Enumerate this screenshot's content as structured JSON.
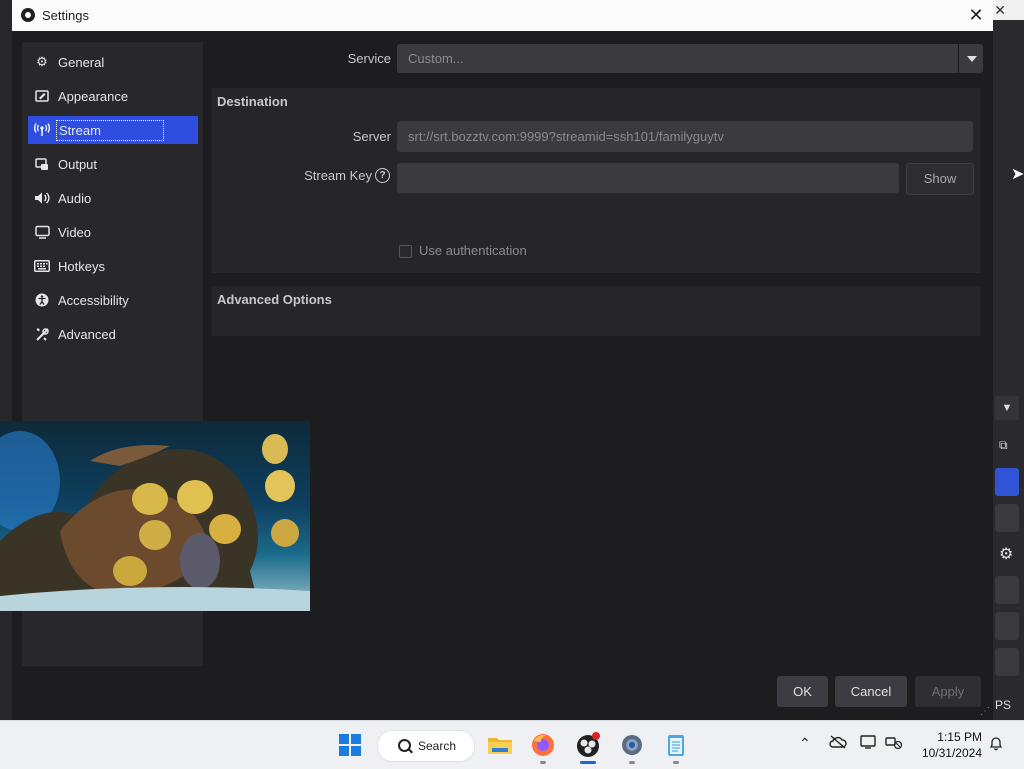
{
  "dialog": {
    "title": "Settings",
    "close_glyph": "✕"
  },
  "sidebar": {
    "items": [
      {
        "label": "General",
        "icon": "gear-icon"
      },
      {
        "label": "Appearance",
        "icon": "appearance-icon"
      },
      {
        "label": "Stream",
        "icon": "antenna-icon",
        "active": true
      },
      {
        "label": "Output",
        "icon": "output-icon"
      },
      {
        "label": "Audio",
        "icon": "speaker-icon"
      },
      {
        "label": "Video",
        "icon": "monitor-icon"
      },
      {
        "label": "Hotkeys",
        "icon": "keyboard-icon"
      },
      {
        "label": "Accessibility",
        "icon": "accessibility-icon"
      },
      {
        "label": "Advanced",
        "icon": "tools-icon"
      }
    ]
  },
  "stream": {
    "service_label": "Service",
    "service_value": "Custom...",
    "destination_title": "Destination",
    "server_label": "Server",
    "server_value": "srt://srt.bozztv.com:9999?streamid=ssh101/familyguytv",
    "stream_key_label": "Stream Key",
    "stream_key_value": "",
    "show_button": "Show",
    "use_auth_label": "Use authentication",
    "use_auth_checked": false,
    "advanced_title": "Advanced Options"
  },
  "footer": {
    "ok": "OK",
    "cancel": "Cancel",
    "apply": "Apply"
  },
  "background": {
    "status_text": "PS"
  },
  "taskbar": {
    "search_label": "Search",
    "time": "1:15 PM",
    "date": "10/31/2024"
  },
  "colors": {
    "accent": "#2f4ee0",
    "dialog_bg": "#1d1d20",
    "group_bg": "#26262a",
    "input_bg": "#3a3a3f"
  }
}
